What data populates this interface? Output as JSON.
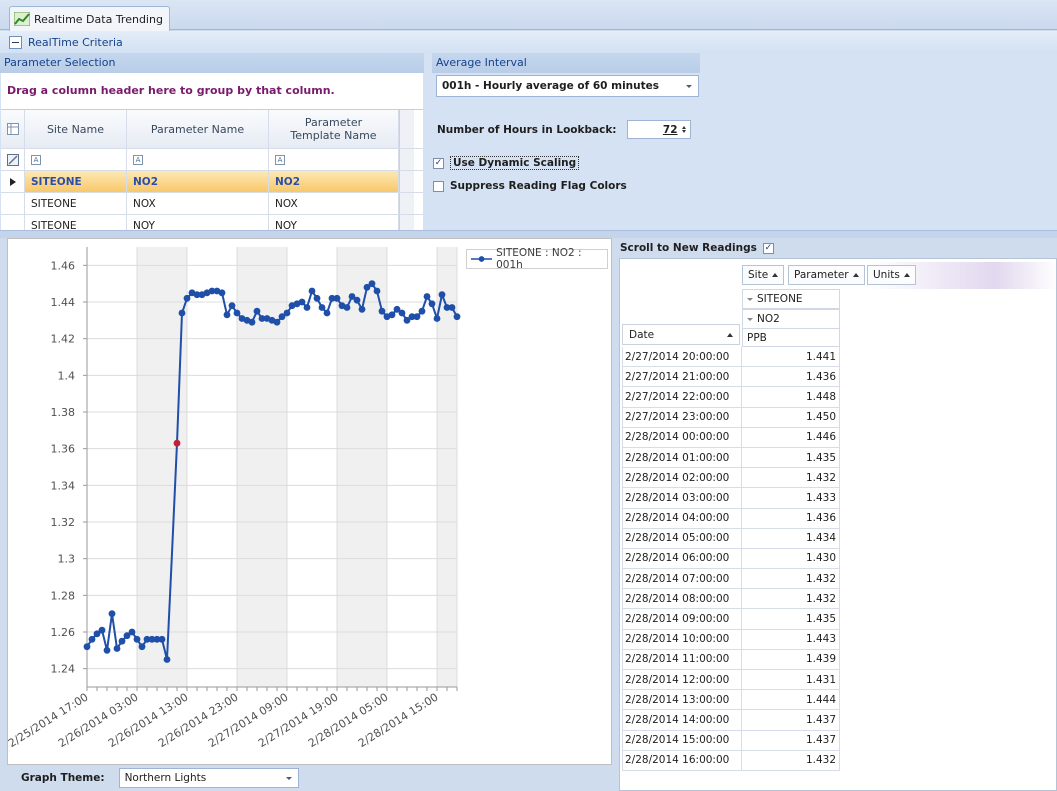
{
  "tab": {
    "title": "Realtime Data Trending",
    "icon": "chart-trend-icon"
  },
  "criteria": {
    "header": "RealTime Criteria",
    "parameter_selection": {
      "title": "Parameter Selection",
      "group_hint": "Drag a column header here to group by that column.",
      "columns": [
        "Site Name",
        "Parameter Name",
        "Parameter Template Name"
      ],
      "rows": [
        {
          "site": "SITEONE",
          "parameter": "NO2",
          "template": "NO2",
          "selected": true
        },
        {
          "site": "SITEONE",
          "parameter": "NOX",
          "template": "NOX",
          "selected": false
        },
        {
          "site": "SITEONE",
          "parameter": "NOY",
          "template": "NOY",
          "selected": false
        }
      ]
    },
    "average_interval": {
      "title": "Average Interval",
      "value": "001h - Hourly average of 60 minutes"
    },
    "lookback": {
      "label": "Number of Hours in Lookback:",
      "value": "72"
    },
    "dynamic_scaling": {
      "label": "Use Dynamic Scaling",
      "checked": true
    },
    "suppress_flags": {
      "label": "Suppress Reading Flag Colors",
      "checked": false
    }
  },
  "chart_data": {
    "type": "line",
    "title": "",
    "xlabel": "",
    "ylabel": "",
    "ylim": [
      1.23,
      1.47
    ],
    "yticks": [
      1.24,
      1.26,
      1.28,
      1.3,
      1.32,
      1.34,
      1.36,
      1.38,
      1.4,
      1.42,
      1.44,
      1.46
    ],
    "ytick_labels": [
      "1.24",
      "1.26",
      "1.28",
      "1.3",
      "1.32",
      "1.34",
      "1.36",
      "1.38",
      "1.4",
      "1.42",
      "1.44",
      "1.46"
    ],
    "xtick_labels": [
      "2/25/2014 17:00",
      "2/26/2014 03:00",
      "2/26/2014 13:00",
      "2/26/2014 23:00",
      "2/27/2014 09:00",
      "2/27/2014 19:00",
      "2/28/2014 05:00",
      "2/28/2014 15:00"
    ],
    "x_start": "2/25/2014 17:00",
    "x_step_hours": 1,
    "grid": true,
    "legend_position": "top-right",
    "series": [
      {
        "name": "SITEONE : NO2 : 001h",
        "color": "#1f4fa8",
        "flag_color": "#c0203a",
        "flagged_index": 18,
        "values": [
          1.252,
          1.256,
          1.259,
          1.261,
          1.25,
          1.27,
          1.251,
          1.255,
          1.258,
          1.26,
          1.256,
          1.252,
          1.256,
          1.256,
          1.256,
          1.256,
          1.245,
          1.303,
          1.363,
          1.434,
          1.442,
          1.445,
          1.444,
          1.444,
          1.445,
          1.446,
          1.446,
          1.445,
          1.433,
          1.438,
          1.434,
          1.431,
          1.43,
          1.429,
          1.435,
          1.431,
          1.431,
          1.43,
          1.429,
          1.432,
          1.434,
          1.438,
          1.439,
          1.44,
          1.437,
          1.446,
          1.442,
          1.437,
          1.434,
          1.442,
          1.442,
          1.438,
          1.437,
          1.443,
          1.441,
          1.436,
          1.448,
          1.45,
          1.446,
          1.435,
          1.432,
          1.433,
          1.436,
          1.434,
          1.43,
          1.432,
          1.432,
          1.435,
          1.443,
          1.439,
          1.431,
          1.444,
          1.437,
          1.437,
          1.432
        ]
      }
    ]
  },
  "graph_theme": {
    "label": "Graph Theme:",
    "value": "Northern Lights"
  },
  "readings": {
    "scroll_label": "Scroll to New Readings",
    "scroll_checked": true,
    "fields": [
      "Site",
      "Parameter",
      "Units"
    ],
    "site": "SITEONE",
    "parameter": "NO2",
    "units": "PPB",
    "date_header": "Date",
    "rows": [
      {
        "date": "2/27/2014 20:00:00",
        "value": "1.441"
      },
      {
        "date": "2/27/2014 21:00:00",
        "value": "1.436"
      },
      {
        "date": "2/27/2014 22:00:00",
        "value": "1.448"
      },
      {
        "date": "2/27/2014 23:00:00",
        "value": "1.450"
      },
      {
        "date": "2/28/2014 00:00:00",
        "value": "1.446"
      },
      {
        "date": "2/28/2014 01:00:00",
        "value": "1.435"
      },
      {
        "date": "2/28/2014 02:00:00",
        "value": "1.432"
      },
      {
        "date": "2/28/2014 03:00:00",
        "value": "1.433"
      },
      {
        "date": "2/28/2014 04:00:00",
        "value": "1.436"
      },
      {
        "date": "2/28/2014 05:00:00",
        "value": "1.434"
      },
      {
        "date": "2/28/2014 06:00:00",
        "value": "1.430"
      },
      {
        "date": "2/28/2014 07:00:00",
        "value": "1.432"
      },
      {
        "date": "2/28/2014 08:00:00",
        "value": "1.432"
      },
      {
        "date": "2/28/2014 09:00:00",
        "value": "1.435"
      },
      {
        "date": "2/28/2014 10:00:00",
        "value": "1.443"
      },
      {
        "date": "2/28/2014 11:00:00",
        "value": "1.439"
      },
      {
        "date": "2/28/2014 12:00:00",
        "value": "1.431"
      },
      {
        "date": "2/28/2014 13:00:00",
        "value": "1.444"
      },
      {
        "date": "2/28/2014 14:00:00",
        "value": "1.437"
      },
      {
        "date": "2/28/2014 15:00:00",
        "value": "1.437"
      },
      {
        "date": "2/28/2014 16:00:00",
        "value": "1.432"
      }
    ]
  }
}
